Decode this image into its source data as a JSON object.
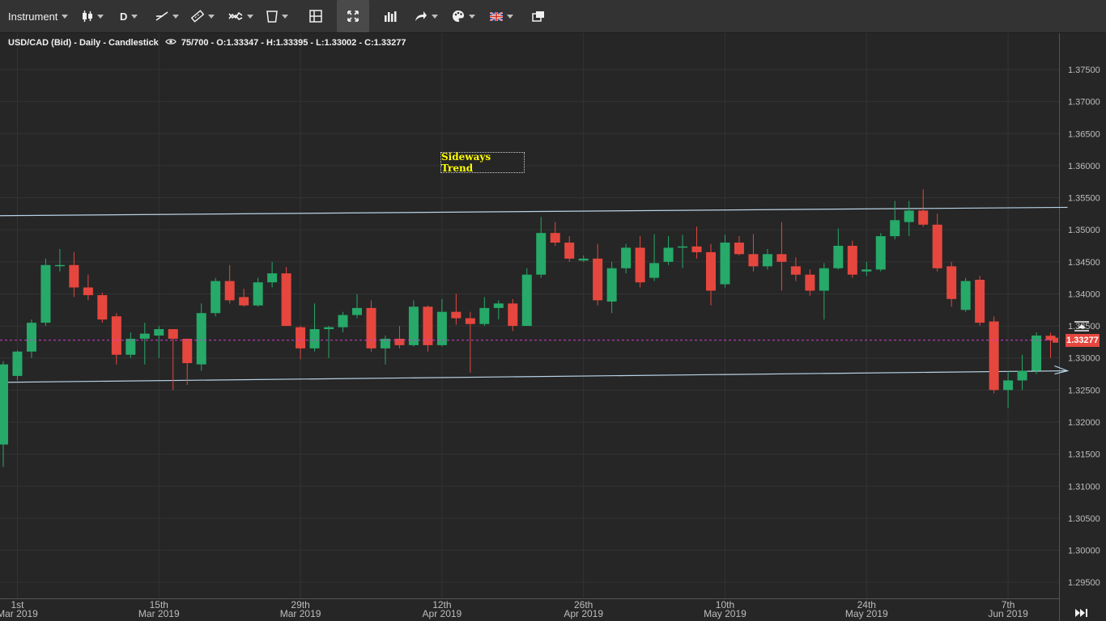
{
  "toolbar": {
    "instrument_label": "Instrument",
    "timeframe_label": "D",
    "icons": [
      "candlestick-type-icon",
      "line-tool-icon",
      "ruler-icon",
      "indicator-icon",
      "delete-icon",
      "layout-icon",
      "fullscreen-icon",
      "volume-bars-icon",
      "share-icon",
      "palette-icon",
      "uk-flag-icon",
      "window-icon"
    ]
  },
  "info": {
    "symbol": "USD/CAD (Bid) - Daily - Candlestick",
    "count": "75/700",
    "ohlc": "O:1.33347 - H:1.33395 - L:1.33002 - C:1.33277"
  },
  "annotation": {
    "label": "Sideways Trend"
  },
  "price_tag": {
    "label": "1.33277",
    "color": "#e5473e"
  },
  "colors": {
    "up": "#26a969",
    "down": "#e5473e",
    "grid": "#333333",
    "trendline": "#b9d3e6",
    "last_price_line": "#d63ad3",
    "annotation_text": "#ffff00"
  },
  "chart_data": {
    "type": "candlestick",
    "y_axis": {
      "range": [
        1.2925,
        1.3808
      ],
      "ticks": [
        "1.37500",
        "1.37000",
        "1.36500",
        "1.36000",
        "1.35500",
        "1.35000",
        "1.34500",
        "1.34000",
        "1.33500",
        "1.33000",
        "1.32500",
        "1.32000",
        "1.31500",
        "1.31000",
        "1.30500",
        "1.30000",
        "1.29500"
      ]
    },
    "x_axis": {
      "ticks": [
        {
          "day": "1st",
          "month": "Mar 2019",
          "index": 1
        },
        {
          "day": "15th",
          "month": "Mar 2019",
          "index": 11
        },
        {
          "day": "29th",
          "month": "Mar 2019",
          "index": 21
        },
        {
          "day": "12th",
          "month": "Apr 2019",
          "index": 31
        },
        {
          "day": "26th",
          "month": "Apr 2019",
          "index": 41
        },
        {
          "day": "10th",
          "month": "May 2019",
          "index": 51
        },
        {
          "day": "24th",
          "month": "May 2019",
          "index": 61
        },
        {
          "day": "7th",
          "month": "Jun 2019",
          "index": 71
        }
      ]
    },
    "last_price": 1.33277,
    "trendlines": [
      {
        "start_index": 0,
        "start_price": 1.3522,
        "end_index": 75.2,
        "end_price": 1.3535
      },
      {
        "start_index": 0,
        "start_price": 1.3262,
        "end_index": 75.2,
        "end_price": 1.328
      }
    ],
    "candles": [
      {
        "o": 1.3165,
        "h": 1.3295,
        "l": 1.313,
        "c": 1.329
      },
      {
        "o": 1.3272,
        "h": 1.3312,
        "l": 1.3265,
        "c": 1.331
      },
      {
        "o": 1.331,
        "h": 1.336,
        "l": 1.33,
        "c": 1.3355
      },
      {
        "o": 1.3355,
        "h": 1.3455,
        "l": 1.335,
        "c": 1.3445
      },
      {
        "o": 1.3445,
        "h": 1.347,
        "l": 1.3435,
        "c": 1.3445
      },
      {
        "o": 1.3445,
        "h": 1.3465,
        "l": 1.3395,
        "c": 1.341
      },
      {
        "o": 1.341,
        "h": 1.343,
        "l": 1.339,
        "c": 1.3398
      },
      {
        "o": 1.3398,
        "h": 1.3402,
        "l": 1.3355,
        "c": 1.336
      },
      {
        "o": 1.3365,
        "h": 1.337,
        "l": 1.329,
        "c": 1.3305
      },
      {
        "o": 1.3305,
        "h": 1.334,
        "l": 1.33,
        "c": 1.333
      },
      {
        "o": 1.333,
        "h": 1.3355,
        "l": 1.329,
        "c": 1.3338
      },
      {
        "o": 1.3335,
        "h": 1.335,
        "l": 1.33,
        "c": 1.3345
      },
      {
        "o": 1.3345,
        "h": 1.3345,
        "l": 1.325,
        "c": 1.333
      },
      {
        "o": 1.333,
        "h": 1.333,
        "l": 1.3258,
        "c": 1.3292
      },
      {
        "o": 1.329,
        "h": 1.3385,
        "l": 1.328,
        "c": 1.337
      },
      {
        "o": 1.337,
        "h": 1.3425,
        "l": 1.3365,
        "c": 1.342
      },
      {
        "o": 1.342,
        "h": 1.3445,
        "l": 1.3385,
        "c": 1.339
      },
      {
        "o": 1.3395,
        "h": 1.3408,
        "l": 1.338,
        "c": 1.3382
      },
      {
        "o": 1.3382,
        "h": 1.3425,
        "l": 1.338,
        "c": 1.3418
      },
      {
        "o": 1.3418,
        "h": 1.345,
        "l": 1.341,
        "c": 1.3432
      },
      {
        "o": 1.3432,
        "h": 1.3442,
        "l": 1.335,
        "c": 1.335
      },
      {
        "o": 1.3348,
        "h": 1.335,
        "l": 1.3298,
        "c": 1.3315
      },
      {
        "o": 1.3315,
        "h": 1.3385,
        "l": 1.331,
        "c": 1.3345
      },
      {
        "o": 1.3345,
        "h": 1.335,
        "l": 1.33,
        "c": 1.3348
      },
      {
        "o": 1.3348,
        "h": 1.3372,
        "l": 1.334,
        "c": 1.3367
      },
      {
        "o": 1.3367,
        "h": 1.34,
        "l": 1.3362,
        "c": 1.3378
      },
      {
        "o": 1.3378,
        "h": 1.339,
        "l": 1.331,
        "c": 1.3315
      },
      {
        "o": 1.3315,
        "h": 1.3335,
        "l": 1.329,
        "c": 1.333
      },
      {
        "o": 1.333,
        "h": 1.335,
        "l": 1.3315,
        "c": 1.332
      },
      {
        "o": 1.332,
        "h": 1.339,
        "l": 1.3318,
        "c": 1.338
      },
      {
        "o": 1.338,
        "h": 1.3382,
        "l": 1.331,
        "c": 1.332
      },
      {
        "o": 1.332,
        "h": 1.3392,
        "l": 1.3318,
        "c": 1.3372
      },
      {
        "o": 1.3372,
        "h": 1.34,
        "l": 1.3352,
        "c": 1.3362
      },
      {
        "o": 1.3362,
        "h": 1.3372,
        "l": 1.3277,
        "c": 1.3353
      },
      {
        "o": 1.3353,
        "h": 1.3395,
        "l": 1.335,
        "c": 1.3378
      },
      {
        "o": 1.3378,
        "h": 1.339,
        "l": 1.336,
        "c": 1.3385
      },
      {
        "o": 1.3385,
        "h": 1.3392,
        "l": 1.3342,
        "c": 1.335
      },
      {
        "o": 1.335,
        "h": 1.344,
        "l": 1.335,
        "c": 1.343
      },
      {
        "o": 1.343,
        "h": 1.352,
        "l": 1.3425,
        "c": 1.3495
      },
      {
        "o": 1.3495,
        "h": 1.3512,
        "l": 1.3475,
        "c": 1.348
      },
      {
        "o": 1.348,
        "h": 1.349,
        "l": 1.345,
        "c": 1.3455
      },
      {
        "o": 1.3452,
        "h": 1.346,
        "l": 1.345,
        "c": 1.3455
      },
      {
        "o": 1.3455,
        "h": 1.3478,
        "l": 1.3382,
        "c": 1.339
      },
      {
        "o": 1.3388,
        "h": 1.345,
        "l": 1.337,
        "c": 1.344
      },
      {
        "o": 1.344,
        "h": 1.3478,
        "l": 1.3432,
        "c": 1.3472
      },
      {
        "o": 1.3472,
        "h": 1.349,
        "l": 1.341,
        "c": 1.3418
      },
      {
        "o": 1.3425,
        "h": 1.3493,
        "l": 1.342,
        "c": 1.3448
      },
      {
        "o": 1.345,
        "h": 1.349,
        "l": 1.3445,
        "c": 1.3472
      },
      {
        "o": 1.3473,
        "h": 1.3492,
        "l": 1.344,
        "c": 1.3474
      },
      {
        "o": 1.3474,
        "h": 1.3505,
        "l": 1.3455,
        "c": 1.3465
      },
      {
        "o": 1.3465,
        "h": 1.3478,
        "l": 1.3382,
        "c": 1.3405
      },
      {
        "o": 1.3415,
        "h": 1.3492,
        "l": 1.341,
        "c": 1.348
      },
      {
        "o": 1.348,
        "h": 1.349,
        "l": 1.346,
        "c": 1.3462
      },
      {
        "o": 1.3462,
        "h": 1.3493,
        "l": 1.3435,
        "c": 1.3443
      },
      {
        "o": 1.3443,
        "h": 1.347,
        "l": 1.3438,
        "c": 1.3462
      },
      {
        "o": 1.3462,
        "h": 1.3512,
        "l": 1.3405,
        "c": 1.345
      },
      {
        "o": 1.3443,
        "h": 1.3457,
        "l": 1.342,
        "c": 1.343
      },
      {
        "o": 1.343,
        "h": 1.3438,
        "l": 1.3397,
        "c": 1.3405
      },
      {
        "o": 1.3405,
        "h": 1.3448,
        "l": 1.336,
        "c": 1.344
      },
      {
        "o": 1.344,
        "h": 1.3502,
        "l": 1.3438,
        "c": 1.3475
      },
      {
        "o": 1.3475,
        "h": 1.3483,
        "l": 1.3425,
        "c": 1.343
      },
      {
        "o": 1.3435,
        "h": 1.345,
        "l": 1.3428,
        "c": 1.3438
      },
      {
        "o": 1.3438,
        "h": 1.3495,
        "l": 1.3435,
        "c": 1.349
      },
      {
        "o": 1.349,
        "h": 1.3545,
        "l": 1.3485,
        "c": 1.3515
      },
      {
        "o": 1.3512,
        "h": 1.3545,
        "l": 1.349,
        "c": 1.353
      },
      {
        "o": 1.353,
        "h": 1.3563,
        "l": 1.3505,
        "c": 1.3508
      },
      {
        "o": 1.3508,
        "h": 1.3525,
        "l": 1.3435,
        "c": 1.344
      },
      {
        "o": 1.3443,
        "h": 1.345,
        "l": 1.338,
        "c": 1.3392
      },
      {
        "o": 1.3375,
        "h": 1.3425,
        "l": 1.3372,
        "c": 1.342
      },
      {
        "o": 1.3422,
        "h": 1.3428,
        "l": 1.335,
        "c": 1.3355
      },
      {
        "o": 1.3357,
        "h": 1.3365,
        "l": 1.3245,
        "c": 1.325
      },
      {
        "o": 1.325,
        "h": 1.328,
        "l": 1.3222,
        "c": 1.3265
      },
      {
        "o": 1.3265,
        "h": 1.3305,
        "l": 1.325,
        "c": 1.328
      },
      {
        "o": 1.328,
        "h": 1.334,
        "l": 1.3275,
        "c": 1.3335
      },
      {
        "o": 1.33347,
        "h": 1.33395,
        "l": 1.33002,
        "c": 1.33277
      }
    ]
  }
}
